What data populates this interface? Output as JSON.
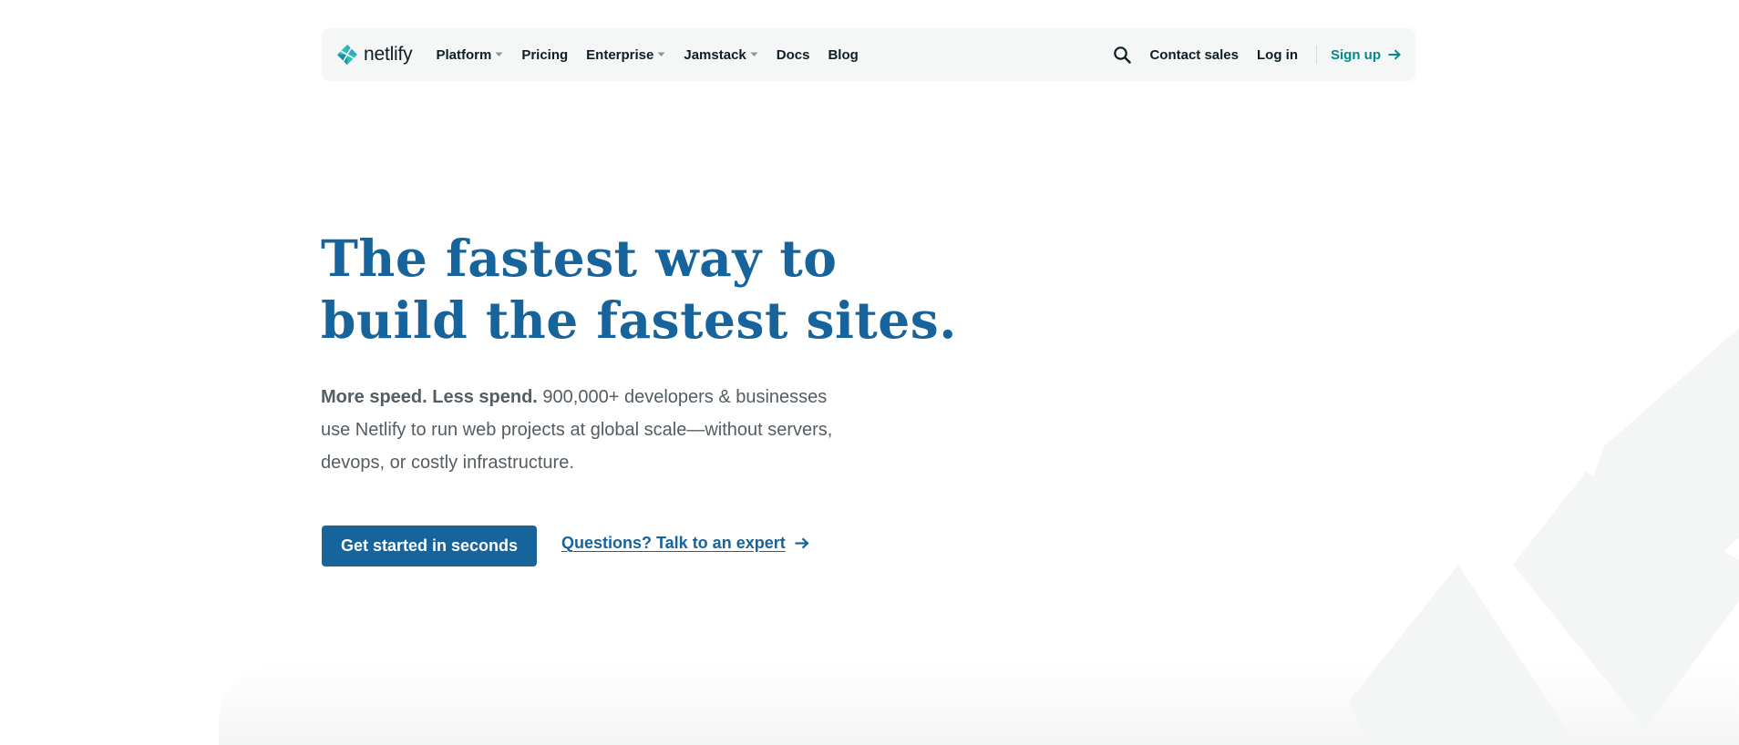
{
  "nav": {
    "logo_text": "netlify",
    "logo_icon": "netlify-diamond-icon",
    "items": [
      {
        "label": "Platform",
        "dropdown": true
      },
      {
        "label": "Pricing",
        "dropdown": false
      },
      {
        "label": "Enterprise",
        "dropdown": true
      },
      {
        "label": "Jamstack",
        "dropdown": true
      },
      {
        "label": "Docs",
        "dropdown": false
      },
      {
        "label": "Blog",
        "dropdown": false
      }
    ],
    "search_icon": "search-icon",
    "contact_sales": "Contact sales",
    "login": "Log in",
    "signup": "Sign up"
  },
  "hero": {
    "title_line1": "The fastest way to",
    "title_line2": "build the fastest sites.",
    "lead": "More speed. Less spend.",
    "body_line1": " 900,000+ developers & businesses",
    "body_line2": "use Netlify to run web projects at global scale—without servers,",
    "body_line3": "devops, or costly infrastructure.",
    "cta_primary": "Get started in seconds",
    "cta_secondary": "Questions? Talk to an expert"
  },
  "colors": {
    "brand_blue": "#17639b",
    "brand_teal": "#018a8a",
    "text_dark": "#0e1e25",
    "text_body": "#545d62",
    "nav_bg": "#f5f7f7"
  }
}
